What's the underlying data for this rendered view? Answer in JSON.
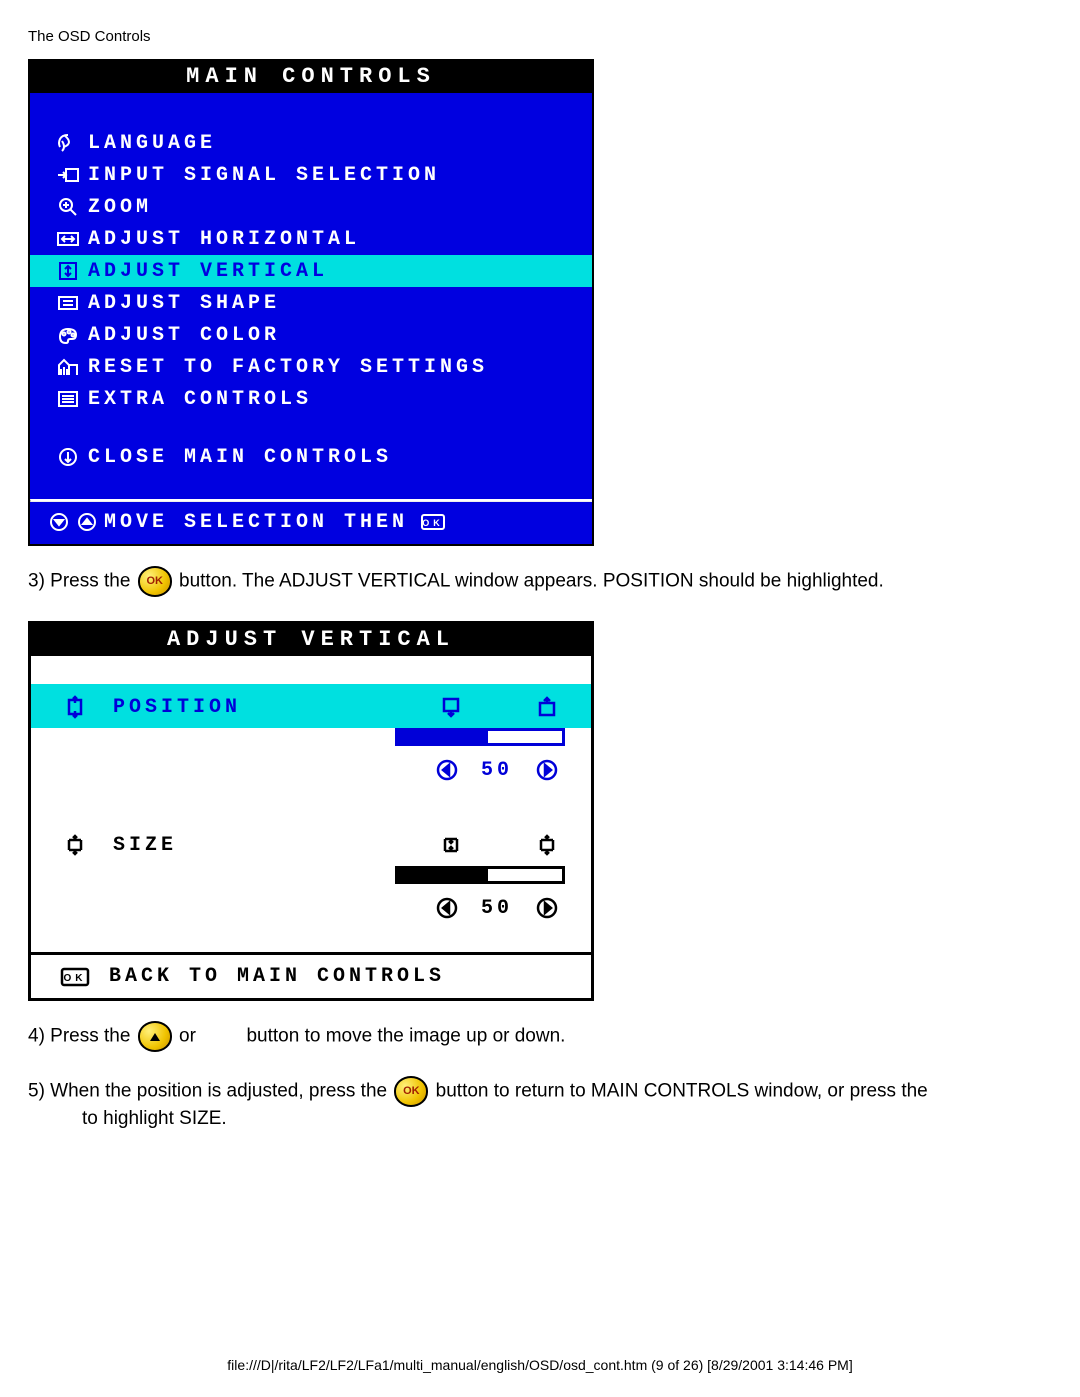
{
  "page_title": "The OSD Controls",
  "main_controls": {
    "title": "MAIN CONTROLS",
    "items": [
      "LANGUAGE",
      "INPUT SIGNAL SELECTION",
      "ZOOM",
      "ADJUST HORIZONTAL",
      "ADJUST VERTICAL",
      "ADJUST SHAPE",
      "ADJUST COLOR",
      "RESET TO FACTORY SETTINGS",
      "EXTRA CONTROLS"
    ],
    "close": "CLOSE MAIN CONTROLS",
    "hint": "MOVE SELECTION THEN"
  },
  "step3": {
    "a": "3) Press the ",
    "b": " button. The ADJUST VERTICAL window appears. POSITION should be highlighted."
  },
  "adjust_vertical": {
    "title": "ADJUST VERTICAL",
    "position": "POSITION",
    "position_value": "50",
    "size": "SIZE",
    "size_value": "50",
    "back": "BACK TO MAIN CONTROLS"
  },
  "step4": {
    "a": "4) Press the ",
    "b": " or",
    "c": "button to move the image up or down."
  },
  "step5": {
    "a": "5) When the position is adjusted, press the ",
    "b": " button to return to MAIN CONTROLS window, or press the",
    "c": "to highlight SIZE."
  },
  "footer_path": "file:///D|/rita/LF2/LF2/LFa1/multi_manual/english/OSD/osd_cont.htm (9 of 26) [8/29/2001 3:14:46 PM]"
}
